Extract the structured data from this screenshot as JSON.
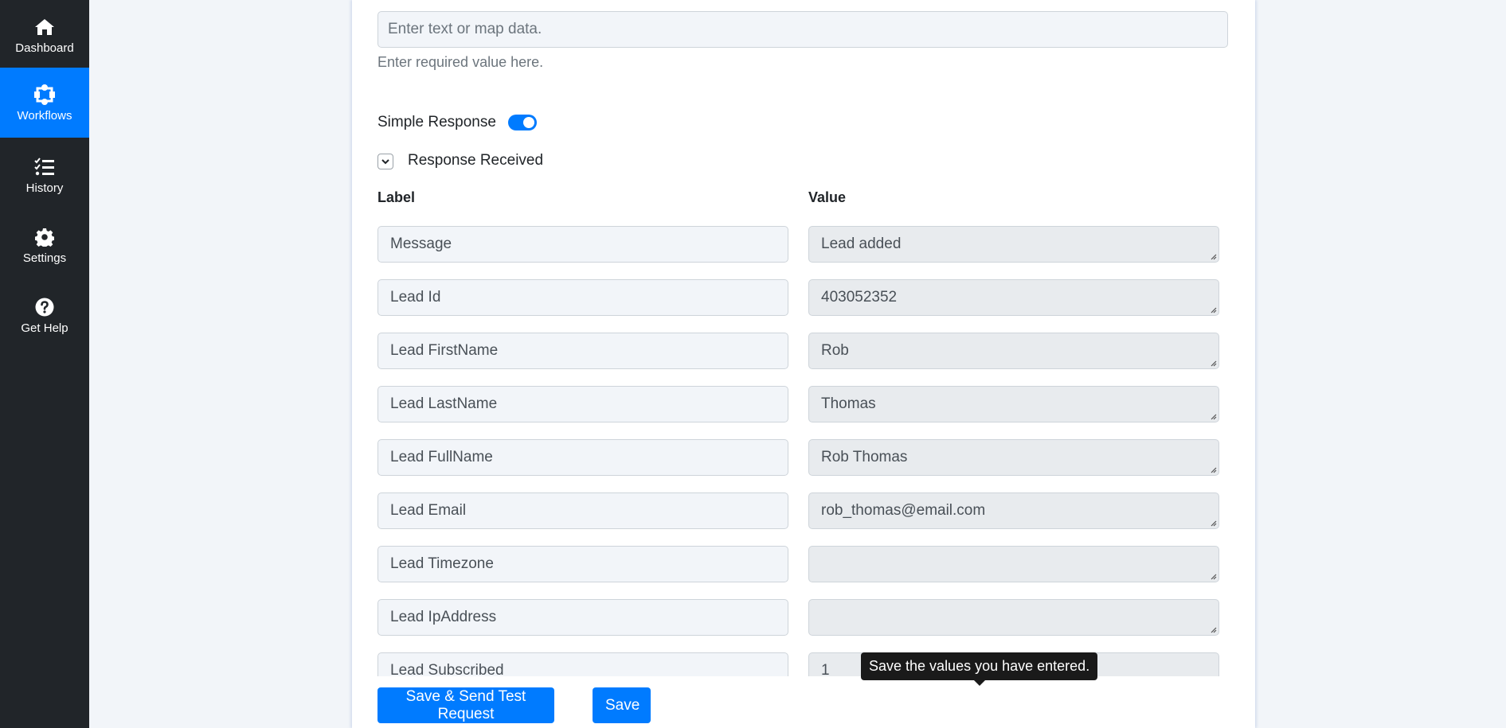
{
  "sidebar": {
    "items": [
      {
        "label": "Dashboard",
        "icon": "home-icon",
        "active": false
      },
      {
        "label": "Workflows",
        "icon": "workflow-icon",
        "active": true
      },
      {
        "label": "History",
        "icon": "checklist-icon",
        "active": false
      },
      {
        "label": "Settings",
        "icon": "gear-icon",
        "active": false
      },
      {
        "label": "Get Help",
        "icon": "question-circle-icon",
        "active": false
      }
    ]
  },
  "form": {
    "input_placeholder": "Enter text or map data.",
    "input_value": "",
    "help_text": "Enter required value here.",
    "simple_response": {
      "label": "Simple Response",
      "enabled": true
    },
    "response_section": {
      "title": "Response Received",
      "expanded": true
    },
    "columns": {
      "label": "Label",
      "value": "Value"
    },
    "rows": [
      {
        "label": "Message",
        "value": "Lead added"
      },
      {
        "label": "Lead Id",
        "value": "403052352"
      },
      {
        "label": "Lead FirstName",
        "value": "Rob"
      },
      {
        "label": "Lead LastName",
        "value": "Thomas"
      },
      {
        "label": "Lead FullName",
        "value": "Rob Thomas"
      },
      {
        "label": "Lead Email",
        "value": "rob_thomas@email.com"
      },
      {
        "label": "Lead Timezone",
        "value": ""
      },
      {
        "label": "Lead IpAddress",
        "value": ""
      },
      {
        "label": "Lead Subscribed",
        "value": "1"
      }
    ]
  },
  "actions": {
    "save_send_label": "Save & Send Test Request",
    "save_label": "Save",
    "save_tooltip": "Save the values you have entered."
  },
  "colors": {
    "accent": "#007bff",
    "sidebar_bg": "#212529",
    "page_bg": "#f2f5f9"
  }
}
